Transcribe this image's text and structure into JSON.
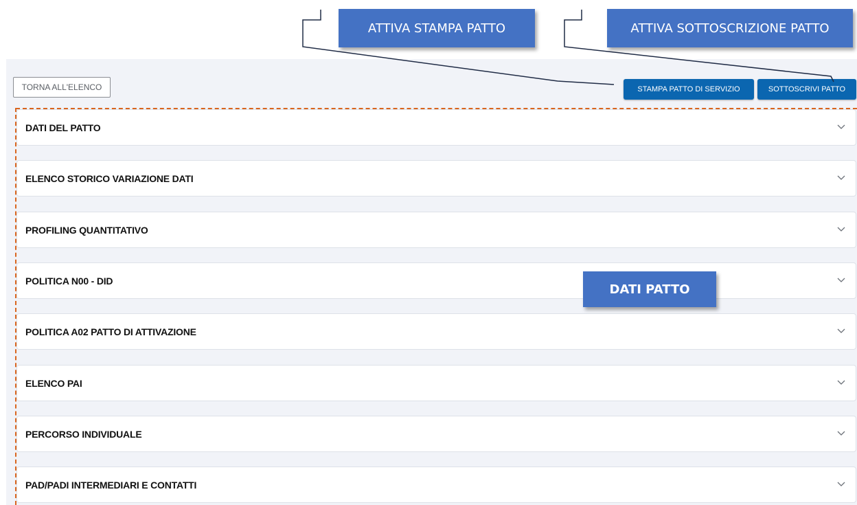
{
  "callouts": {
    "print": "ATTIVA STAMPA PATTO",
    "sign": "ATTIVA SOTTOSCRIZIONE PATTO",
    "data": "DATI PATTO"
  },
  "toolbar": {
    "back_label": "TORNA ALL'ELENCO",
    "print_label": "STAMPA PATTO DI SERVIZIO",
    "sign_label": "SOTTOSCRIVI PATTO"
  },
  "sections": [
    {
      "title": "DATI DEL PATTO",
      "icon": "chevron-down-icon"
    },
    {
      "title": "ELENCO STORICO VARIAZIONE DATI",
      "icon": "chevron-down-icon"
    },
    {
      "title": "PROFILING QUANTITATIVO",
      "icon": "chevron-down-icon"
    },
    {
      "title": "POLITICA N00 - DID",
      "icon": "chevron-down-icon"
    },
    {
      "title": "POLITICA A02 PATTO DI ATTIVAZIONE",
      "icon": "chevron-down-icon"
    },
    {
      "title": "ELENCO PAI",
      "icon": "chevron-down-icon"
    },
    {
      "title": "PERCORSO INDIVIDUALE",
      "icon": "chevron-down-icon"
    },
    {
      "title": "PAD/PADI INTERMEDIARI E CONTATTI",
      "icon": "chevron-down-icon"
    }
  ],
  "colors": {
    "primary_button": "#0b66b0",
    "callout": "#4472c4",
    "highlight_border": "#d9651e",
    "background": "#f1f3f8"
  }
}
